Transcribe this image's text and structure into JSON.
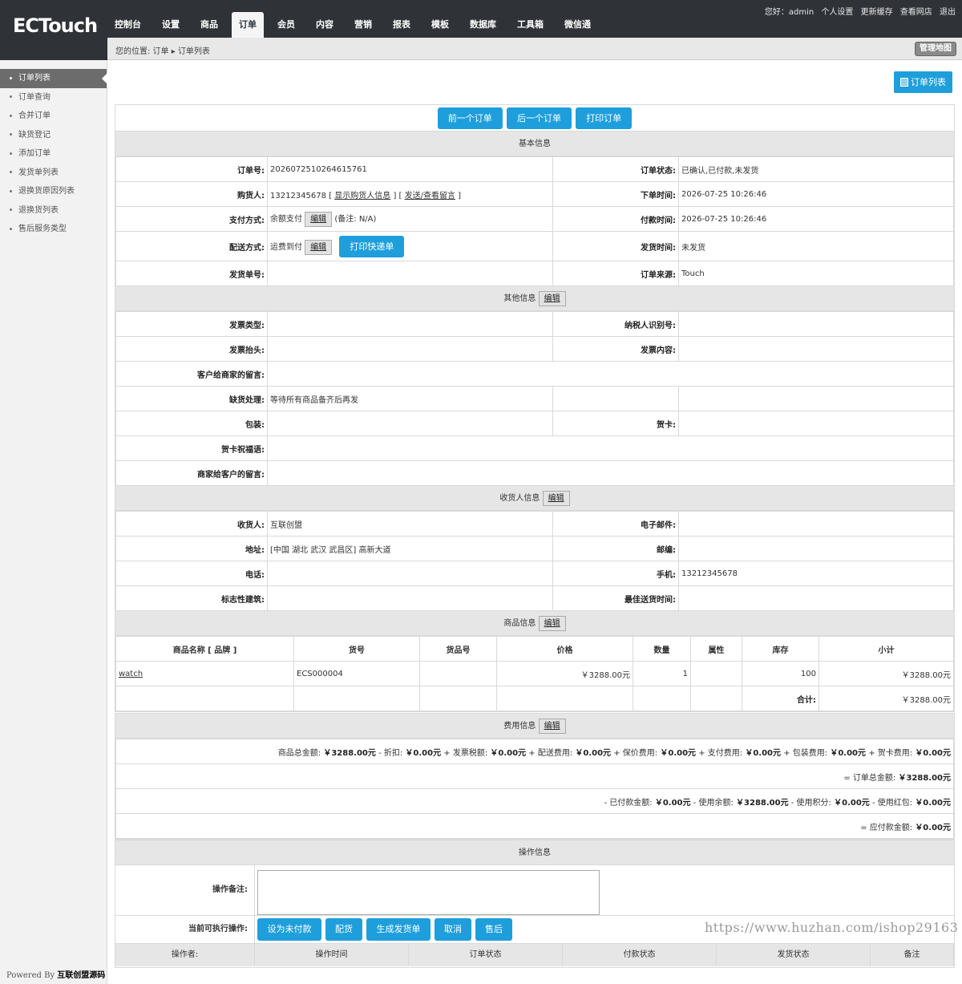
{
  "logo": {
    "text": "ECTouch"
  },
  "top_links": {
    "greeting": "您好：admin",
    "personal": "个人设置",
    "refresh_cache": "更新缓存",
    "view_shop": "查看网店",
    "logout": "退出"
  },
  "nav": [
    "控制台",
    "设置",
    "商品",
    "订单",
    "会员",
    "内容",
    "营销",
    "报表",
    "模板",
    "数据库",
    "工具箱",
    "微信通"
  ],
  "nav_active": "订单",
  "breadcrumb": {
    "text": "您的位置: 订单 ▸ 订单列表"
  },
  "sitemap_label": "管理地图",
  "sidebar": [
    "订单列表",
    "订单查询",
    "合并订单",
    "缺货登记",
    "添加订单",
    "发货单列表",
    "退换货原因列表",
    "退换货列表",
    "售后服务类型"
  ],
  "powered": {
    "prefix": "Powered By ",
    "brand": "互联创盟源码"
  },
  "order_list_btn": "订单列表",
  "nav_buttons": {
    "prev": "前一个订单",
    "next": "后一个订单",
    "print": "打印订单"
  },
  "basic": {
    "title": "基本信息",
    "order_sn_label": "订单号:",
    "order_sn": "2026072510264615761",
    "status_label": "订单状态:",
    "status": "已确认,已付款,未发货",
    "buyer_label": "购货人:",
    "buyer": "13212345678",
    "buyer_show": "显示购货人信息",
    "buyer_msg": "发送/查看留言",
    "order_time_label": "下单时间:",
    "order_time": "2026-07-25 10:26:46",
    "pay_label": "支付方式:",
    "pay": "余额支付",
    "pay_note": "(备注: N/A)",
    "pay_time_label": "付款时间:",
    "pay_time": "2026-07-25 10:26:46",
    "ship_label": "配送方式:",
    "ship": "运费到付",
    "print_express": "打印快递单",
    "ship_time_label": "发货时间:",
    "ship_time": "未发货",
    "invoice_no_label": "发货单号:",
    "invoice_no": "",
    "source_label": "订单来源:",
    "source": "Touch"
  },
  "edit_label": "编辑",
  "other": {
    "title": "其他信息",
    "inv_type_label": "发票类型:",
    "tax_id_label": "纳税人识别号:",
    "inv_title_label": "发票抬头:",
    "inv_content_label": "发票内容:",
    "client_msg_label": "客户给商家的留言:",
    "shortage_label": "缺货处理:",
    "shortage": "等待所有商品备齐后再发",
    "pack_label": "包装:",
    "card_label": "贺卡:",
    "card_msg_label": "贺卡祝福语:",
    "merchant_msg_label": "商家给客户的留言:"
  },
  "consignee": {
    "title": "收货人信息",
    "name_label": "收货人:",
    "name": "互联创盟",
    "email_label": "电子邮件:",
    "email": "",
    "addr_label": "地址:",
    "addr": "[中国 湖北 武汉 武昌区] 高新大道",
    "zip_label": "邮编:",
    "zip": "",
    "tel_label": "电话:",
    "tel": "",
    "mobile_label": "手机:",
    "mobile": "13212345678",
    "building_label": "标志性建筑:",
    "best_time_label": "最佳送货时间:"
  },
  "goods": {
    "title": "商品信息",
    "headers": [
      "商品名称 [ 品牌 ]",
      "货号",
      "货品号",
      "价格",
      "数量",
      "属性",
      "库存",
      "小计"
    ],
    "row": {
      "name": "watch",
      "sn": "ECS000004",
      "product_sn": "",
      "price": "￥3288.00元",
      "qty": "1",
      "attr": "",
      "stock": "100",
      "subtotal": "￥3288.00元"
    },
    "total_label": "合计:",
    "total": "￥3288.00元"
  },
  "fee": {
    "title": "费用信息",
    "line1": [
      {
        "t": "商品总金额: ",
        "v": "￥3288.00元"
      },
      {
        "t": " - 折扣: ",
        "v": "￥0.00元"
      },
      {
        "t": " + 发票税额: ",
        "v": "￥0.00元"
      },
      {
        "t": " + 配送费用: ",
        "v": "￥0.00元"
      },
      {
        "t": " + 保价费用: ",
        "v": "￥0.00元"
      },
      {
        "t": " + 支付费用: ",
        "v": "￥0.00元"
      },
      {
        "t": " + 包装费用: ",
        "v": "￥0.00元"
      },
      {
        "t": " + 贺卡费用: ",
        "v": "￥0.00元"
      }
    ],
    "line2": [
      {
        "t": "= 订单总金额: ",
        "v": "￥3288.00元"
      }
    ],
    "line3": [
      {
        "t": "- 已付款金额: ",
        "v": "￥0.00元"
      },
      {
        "t": " - 使用余额: ",
        "v": "￥3288.00元"
      },
      {
        "t": " - 使用积分: ",
        "v": "￥0.00元"
      },
      {
        "t": " - 使用红包: ",
        "v": "￥0.00元"
      }
    ],
    "line4": [
      {
        "t": "= 应付款金额: ",
        "v": "￥0.00元"
      }
    ]
  },
  "ops": {
    "title": "操作信息",
    "note_label": "操作备注:",
    "actions_label": "当前可执行操作:",
    "actions": [
      "设为未付款",
      "配货",
      "生成发货单",
      "取消",
      "售后"
    ],
    "log_headers": [
      "操作者:",
      "操作时间",
      "订单状态",
      "付款状态",
      "发货状态",
      "备注"
    ]
  },
  "watermark": "https://www.huzhan.com/ishop29163"
}
